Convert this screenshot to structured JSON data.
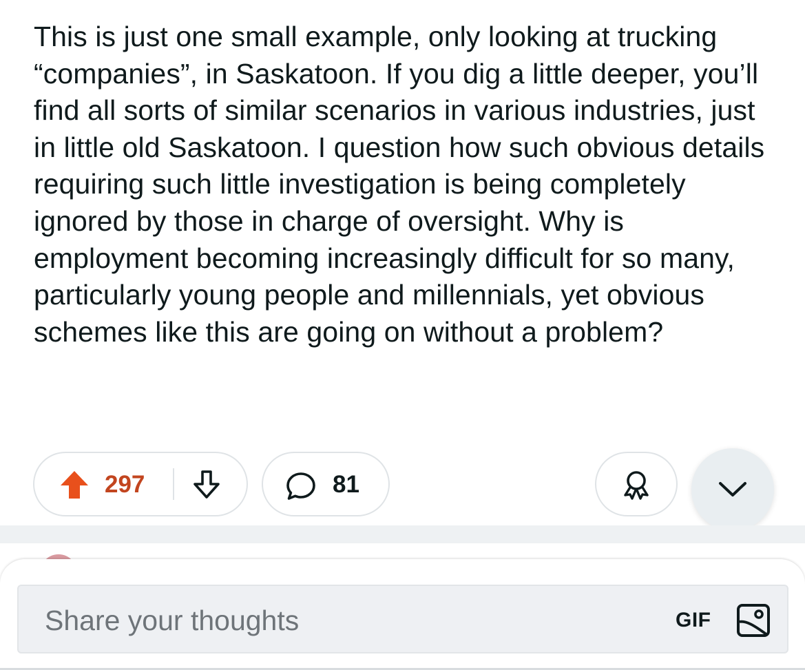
{
  "post": {
    "body": "This is just one small example, only looking at trucking “companies”, in Saskatoon. If you dig a little deeper, you’ll find all sorts of similar scenarios in various industries, just in little old Saskatoon. I question how such obvious details requiring such little investigation is being completely ignored by those in charge of oversight. Why is employment becoming increasingly difficult for so many, particularly young people and millennials, yet obvious schemes like this are going on without a problem?"
  },
  "actions": {
    "score": "297",
    "comment_count": "81",
    "upvote_state": "active",
    "upvote_color": "#e8501c",
    "score_color": "#c2451f",
    "icons": {
      "upvote": "upvote-arrow-icon",
      "downvote": "downvote-arrow-icon",
      "comments": "comment-bubble-icon",
      "award": "award-ribbon-icon",
      "expand": "chevron-down-icon"
    }
  },
  "composer": {
    "placeholder": "Share your thoughts",
    "gif_label": "GIF",
    "image_icon": "image-icon"
  }
}
